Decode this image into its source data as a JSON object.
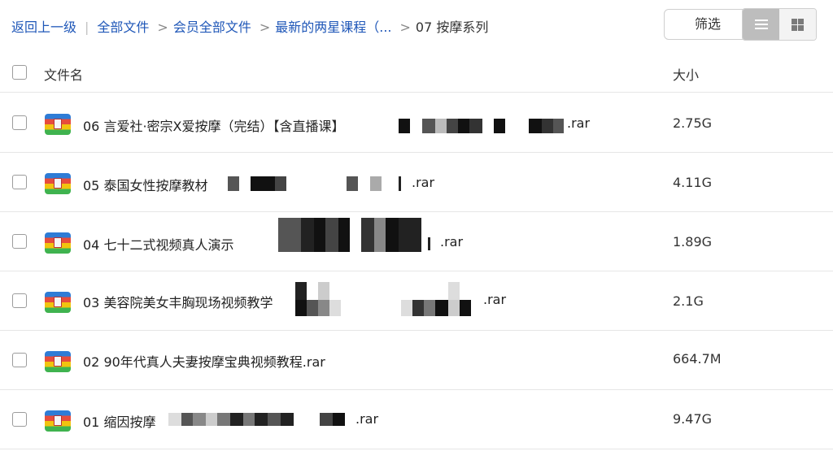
{
  "breadcrumb": {
    "back": "返回上一级",
    "sep": "|",
    "items": [
      "全部文件",
      "会员全部文件",
      "最新的两星课程（...",
      "07 按摩系列"
    ],
    "arrow": ">"
  },
  "toolbar": {
    "filter_label": "筛选",
    "view_list": "list-view",
    "view_grid": "grid-view"
  },
  "table": {
    "col_name": "文件名",
    "col_size": "大小"
  },
  "files": [
    {
      "name": "06 言爱社·密宗X爱按摩（完结）【含直播课】",
      "ext": ".rar",
      "size": "2.75G"
    },
    {
      "name": "05 泰国女性按摩教材",
      "ext": ".rar",
      "size": "4.11G"
    },
    {
      "name": "04 七十二式视频真人演示",
      "ext": ".rar",
      "size": "1.89G"
    },
    {
      "name": "03 美容院美女丰胸现场视频教学",
      "ext": ".rar",
      "size": "2.1G"
    },
    {
      "name": "02 90年代真人夫妻按摩宝典视频教程.rar",
      "ext": "",
      "size": "664.7M"
    },
    {
      "name": "01 缩因按摩",
      "ext": ".rar",
      "size": "9.47G"
    }
  ],
  "icons": {
    "file": "rar-archive-icon"
  },
  "colors": {
    "link": "#1f57b8",
    "divider": "#e6e6e6"
  }
}
